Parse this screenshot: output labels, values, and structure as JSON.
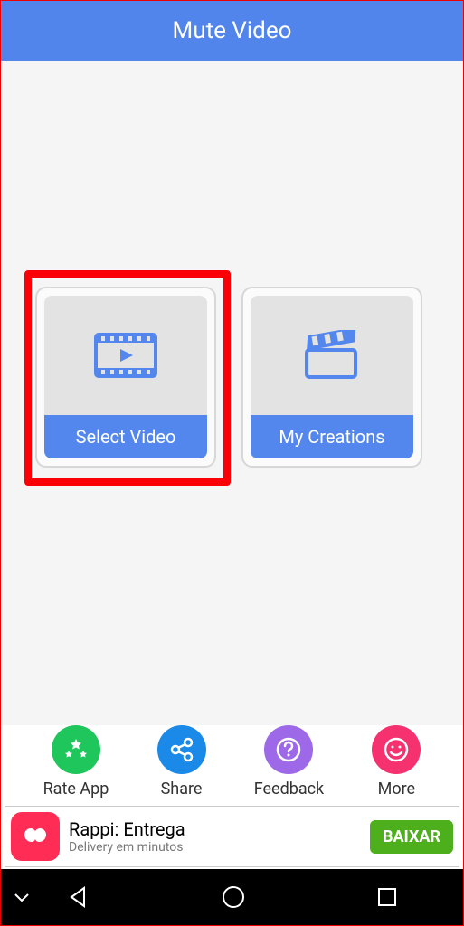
{
  "header": {
    "title": "Mute Video"
  },
  "cards": {
    "select_video": {
      "label": "Select Video",
      "icon": "video-play-icon"
    },
    "my_creations": {
      "label": "My Creations",
      "icon": "clapperboard-icon"
    }
  },
  "bottom": {
    "rate": {
      "label": "Rate App",
      "color": "#1fc65c"
    },
    "share": {
      "label": "Share",
      "color": "#1a89e8"
    },
    "feedback": {
      "label": "Feedback",
      "color": "#9d69e8"
    },
    "more": {
      "label": "More",
      "color": "#f5316f"
    }
  },
  "ad": {
    "title": "Rappi: Entrega",
    "subtitle": "Delivery em minutos",
    "button": "BAIXAR"
  }
}
